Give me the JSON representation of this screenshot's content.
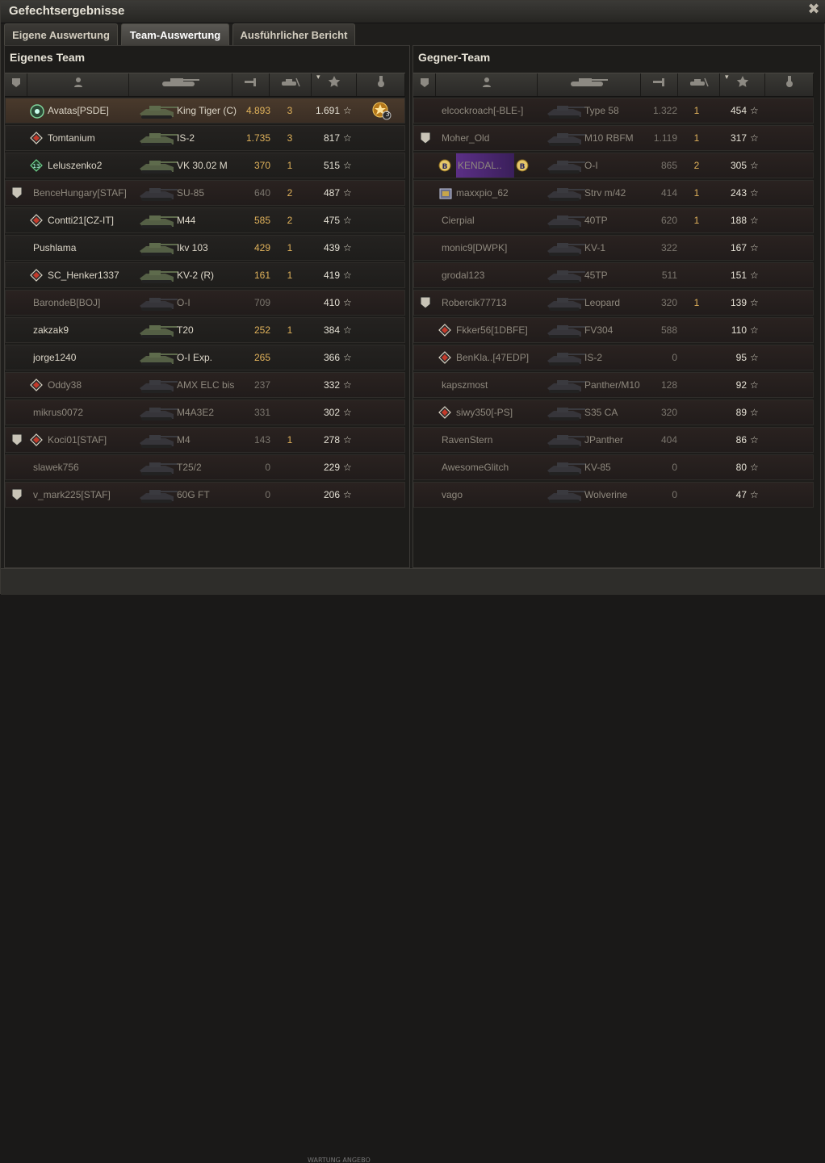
{
  "window": {
    "title": "Gefechtsergebnisse",
    "close_glyph": "✖"
  },
  "tabs": [
    {
      "label": "Eigene Auswertung",
      "active": false
    },
    {
      "label": "Team-Auswertung",
      "active": true
    },
    {
      "label": "Ausführlicher Bericht",
      "active": false
    }
  ],
  "header_icons": [
    "platoon-icon",
    "player-icon",
    "tank-icon",
    "damage-icon",
    "kills-icon",
    "xp-icon",
    "medal-icon"
  ],
  "teams": [
    {
      "title": "Eigenes Team",
      "rows": [
        {
          "player": "Avatas[PSDE]",
          "badge": "green-circle",
          "tank": "King Tiger (C)",
          "damage": "4.893",
          "kills": "3",
          "xp": "1.691",
          "me": true,
          "dead": false,
          "platoon": false,
          "medal": "3"
        },
        {
          "player": "Tomtanium",
          "badge": "diamond",
          "tank": "IS-2",
          "damage": "1.735",
          "kills": "3",
          "xp": "817",
          "dead": false,
          "platoon": false
        },
        {
          "player": "Leluszenko2",
          "badge": "green-diamond",
          "tank": "VK 30.02 M",
          "damage": "370",
          "kills": "1",
          "xp": "515",
          "dead": false,
          "platoon": false
        },
        {
          "player": "BenceHungary[STAF]",
          "badge": "",
          "tank": "SU-85",
          "damage": "640",
          "kills": "2",
          "xp": "487",
          "dead": true,
          "platoon": true
        },
        {
          "player": "Contti21[CZ-IT]",
          "badge": "diamond",
          "tank": "M44",
          "damage": "585",
          "kills": "2",
          "xp": "475",
          "dead": false,
          "platoon": false
        },
        {
          "player": "Pushlama",
          "badge": "",
          "tank": "Ikv 103",
          "damage": "429",
          "kills": "1",
          "xp": "439",
          "dead": false,
          "platoon": false
        },
        {
          "player": "SC_Henker1337",
          "badge": "diamond",
          "tank": "KV-2 (R)",
          "damage": "161",
          "kills": "1",
          "xp": "419",
          "dead": false,
          "platoon": false
        },
        {
          "player": "BarondeB[BOJ]",
          "badge": "",
          "tank": "O-I",
          "damage": "709",
          "kills": "",
          "xp": "410",
          "dead": true,
          "platoon": false
        },
        {
          "player": "zakzak9",
          "badge": "",
          "tank": "T20",
          "damage": "252",
          "kills": "1",
          "xp": "384",
          "dead": false,
          "platoon": false
        },
        {
          "player": "jorge1240",
          "badge": "",
          "tank": "O-I Exp.",
          "damage": "265",
          "kills": "",
          "xp": "366",
          "dead": false,
          "platoon": false
        },
        {
          "player": "Oddy38",
          "badge": "diamond",
          "tank": "AMX ELC bis",
          "damage": "237",
          "kills": "",
          "xp": "332",
          "dead": true,
          "platoon": false
        },
        {
          "player": "mikrus0072",
          "badge": "",
          "tank": "M4A3E2",
          "damage": "331",
          "kills": "",
          "xp": "302",
          "dead": true,
          "platoon": false
        },
        {
          "player": "Koci01[STAF]",
          "badge": "diamond",
          "tank": "M4",
          "damage": "143",
          "kills": "1",
          "xp": "278",
          "dead": true,
          "platoon": true
        },
        {
          "player": "slawek756",
          "badge": "",
          "tank": "T25/2",
          "damage": "0",
          "kills": "",
          "xp": "229",
          "dead": true,
          "platoon": false
        },
        {
          "player": "v_mark225[STAF]",
          "badge": "",
          "tank": "60G FT",
          "damage": "0",
          "kills": "",
          "xp": "206",
          "dead": true,
          "platoon": true
        }
      ]
    },
    {
      "title": "Gegner-Team",
      "rows": [
        {
          "player": "elcockroach[-BLE-]",
          "badge": "",
          "tank": "Type 58",
          "damage": "1.322",
          "kills": "1",
          "xp": "454",
          "dead": true,
          "platoon": false
        },
        {
          "player": "Moher_Old",
          "badge": "",
          "tank": "M10 RBFM",
          "damage": "1.119",
          "kills": "1",
          "xp": "317",
          "dead": true,
          "platoon": true
        },
        {
          "player": "KENDAL..",
          "badge": "b-coin",
          "tank": "O-I",
          "damage": "865",
          "kills": "2",
          "xp": "305",
          "dead": true,
          "platoon": false,
          "highlight": true
        },
        {
          "player": "maxxpio_62",
          "badge": "crate",
          "tank": "Strv m/42",
          "damage": "414",
          "kills": "1",
          "xp": "243",
          "dead": true,
          "platoon": false
        },
        {
          "player": "Cierpial",
          "badge": "",
          "tank": "40TP",
          "damage": "620",
          "kills": "1",
          "xp": "188",
          "dead": true,
          "platoon": false
        },
        {
          "player": "monic9[DWPK]",
          "badge": "",
          "tank": "KV-1",
          "damage": "322",
          "kills": "",
          "xp": "167",
          "dead": true,
          "platoon": false
        },
        {
          "player": "grodal123",
          "badge": "",
          "tank": "45TP",
          "damage": "511",
          "kills": "",
          "xp": "151",
          "dead": true,
          "platoon": false
        },
        {
          "player": "Robercik77713",
          "badge": "",
          "tank": "Leopard",
          "damage": "320",
          "kills": "1",
          "xp": "139",
          "dead": true,
          "platoon": true
        },
        {
          "player": "Fkker56[1DBFE]",
          "badge": "diamond",
          "tank": "FV304",
          "damage": "588",
          "kills": "",
          "xp": "110",
          "dead": true,
          "platoon": false
        },
        {
          "player": "BenKla..[47EDP]",
          "badge": "diamond",
          "tank": "IS-2",
          "damage": "0",
          "kills": "",
          "xp": "95",
          "dead": true,
          "platoon": false
        },
        {
          "player": "kapszmost",
          "badge": "",
          "tank": "Panther/M10",
          "damage": "128",
          "kills": "",
          "xp": "92",
          "dead": true,
          "platoon": false
        },
        {
          "player": "siwy350[-PS]",
          "badge": "diamond",
          "tank": "S35 CA",
          "damage": "320",
          "kills": "",
          "xp": "89",
          "dead": true,
          "platoon": false
        },
        {
          "player": "RavenStern",
          "badge": "",
          "tank": "JPanther",
          "damage": "404",
          "kills": "",
          "xp": "86",
          "dead": true,
          "platoon": false
        },
        {
          "player": "AwesomeGlitch",
          "badge": "",
          "tank": "KV-85",
          "damage": "0",
          "kills": "",
          "xp": "80",
          "dead": true,
          "platoon": false
        },
        {
          "player": "vago",
          "badge": "",
          "tank": "Wolverine",
          "damage": "0",
          "kills": "",
          "xp": "47",
          "dead": true,
          "platoon": false
        }
      ]
    }
  ],
  "bottom_strip_text": "WARTUNG ANGEBO",
  "colors": {
    "damage": "#e0b25b",
    "highlight": "#5b2f86",
    "me_row": "#4a3a2c"
  }
}
